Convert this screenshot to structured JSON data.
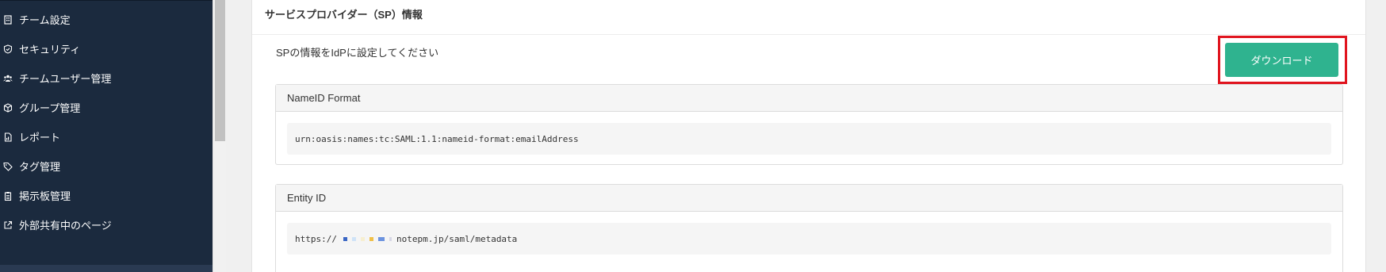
{
  "sidebar": {
    "items": [
      {
        "label": "チーム設定",
        "icon": "building-icon"
      },
      {
        "label": "セキュリティ",
        "icon": "shield-icon"
      },
      {
        "label": "チームユーザー管理",
        "icon": "users-icon"
      },
      {
        "label": "グループ管理",
        "icon": "cube-icon"
      },
      {
        "label": "レポート",
        "icon": "report-icon"
      },
      {
        "label": "タグ管理",
        "icon": "tag-icon"
      },
      {
        "label": "掲示板管理",
        "icon": "clipboard-icon"
      },
      {
        "label": "外部共有中のページ",
        "icon": "external-link-icon"
      }
    ]
  },
  "main": {
    "section_title": "サービスプロバイダー（SP）情報",
    "description": "SPの情報をIdPに設定してください",
    "download_label": "ダウンロード",
    "nameid": {
      "header": "NameID Format",
      "value": "urn:oasis:names:tc:SAML:1.1:nameid-format:emailAddress"
    },
    "entity": {
      "header": "Entity ID",
      "value_prefix": "https://",
      "value_suffix": "notepm.jp/saml/metadata"
    }
  },
  "colors": {
    "sidebar_bg": "#1b2a3e",
    "accent_button": "#2fb38f",
    "highlight_frame": "#e0141e"
  }
}
